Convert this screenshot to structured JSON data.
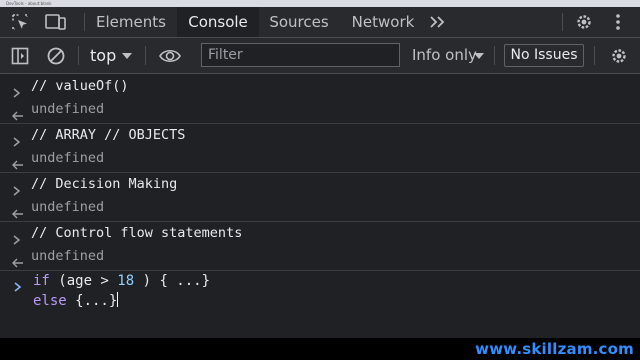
{
  "titlebar": {
    "text": "DevTools - about:blank"
  },
  "tabs": [
    {
      "label": "Elements"
    },
    {
      "label": "Console"
    },
    {
      "label": "Sources"
    },
    {
      "label": "Network"
    }
  ],
  "toolbar": {
    "context": "top",
    "filter_placeholder": "Filter",
    "levels": "Info only",
    "issues": "No Issues"
  },
  "console": {
    "entries": [
      {
        "command": "// valueOf()",
        "result": "undefined"
      },
      {
        "command": "// ARRAY // OBJECTS",
        "result": "undefined"
      },
      {
        "command": "// Decision Making",
        "result": "undefined"
      },
      {
        "command": "// Control flow statements",
        "result": "undefined"
      }
    ],
    "prompt": {
      "line1": {
        "kw_if": "if",
        "pre": " (age > ",
        "num": "18",
        "post": " ) { ...}"
      },
      "line2": {
        "kw_else": "else",
        "text": " {...}"
      }
    }
  },
  "watermark": {
    "text": "www.skillzam.com"
  },
  "colors": {
    "accent": "#8ab4f8",
    "background": "#202124",
    "toolbar": "#292a2d"
  },
  "icons": [
    "inspect-icon",
    "device-icon",
    "more-tabs-icon",
    "settings-icon",
    "more-options-icon",
    "sidebar-icon",
    "clear-icon",
    "eye-icon",
    "chevron-right-icon",
    "return-arrow-icon"
  ]
}
